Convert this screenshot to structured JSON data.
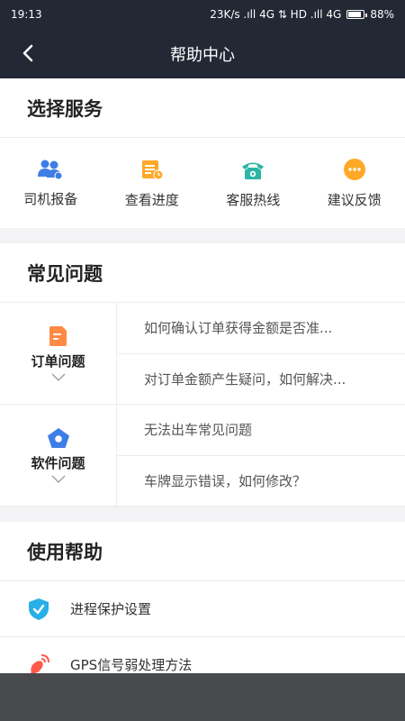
{
  "status": {
    "time": "19:13",
    "network": "23K/s .ıll 4G ⇅ HD .ıll 4G",
    "battery": "88%"
  },
  "header": {
    "title": "帮助中心"
  },
  "services": {
    "title": "选择服务",
    "items": [
      {
        "label": "司机报备",
        "icon": "driver-report-icon"
      },
      {
        "label": "查看进度",
        "icon": "progress-icon"
      },
      {
        "label": "客服热线",
        "icon": "phone-icon"
      },
      {
        "label": "建议反馈",
        "icon": "feedback-icon"
      }
    ]
  },
  "faq": {
    "title": "常见问题",
    "groups": [
      {
        "category": "订单问题",
        "icon": "order-icon",
        "items": [
          "如何确认订单获得金额是否准...",
          "对订单金额产生疑问，如何解决..."
        ]
      },
      {
        "category": "软件问题",
        "icon": "software-icon",
        "items": [
          "无法出车常见问题",
          "车牌显示错误，如何修改？"
        ]
      }
    ]
  },
  "help": {
    "title": "使用帮助",
    "items": [
      {
        "label": "进程保护设置",
        "icon": "shield-icon"
      },
      {
        "label": "GPS信号弱处理方法",
        "icon": "satellite-icon"
      }
    ]
  },
  "colors": {
    "header_bg": "#222834",
    "blue": "#3d7ee6",
    "orange": "#ffa928",
    "teal": "#2bb5a6"
  }
}
